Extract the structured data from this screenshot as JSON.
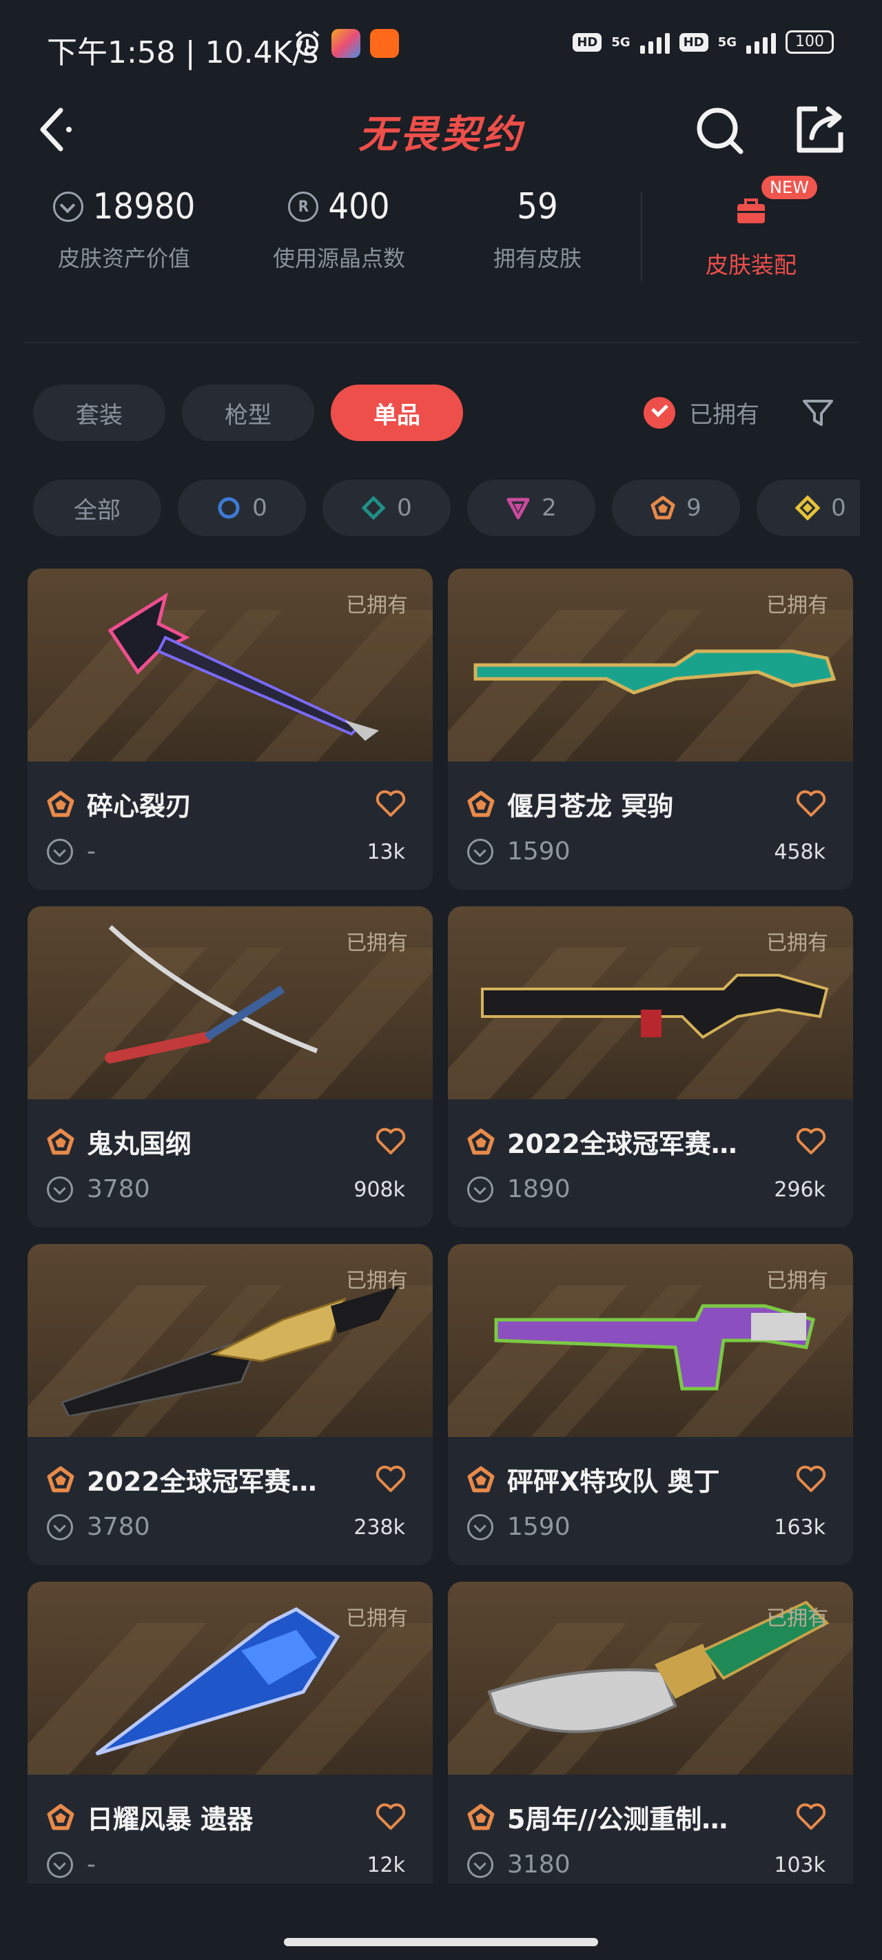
{
  "status_bar": {
    "time_speed": "下午1:58 | 10.4K/s",
    "hd1": "HD",
    "net1": "5G",
    "hd2": "HD",
    "net2": "5G",
    "battery": "100"
  },
  "header": {
    "title": "无畏契约",
    "back_icon": "back-arrow-icon",
    "search_icon": "search-icon",
    "share_icon": "share-icon"
  },
  "stats": {
    "asset_value": "18980",
    "asset_value_label": "皮肤资产价值",
    "radianite": "400",
    "radianite_label": "使用源晶点数",
    "skins_owned": "59",
    "skins_owned_label": "拥有皮肤",
    "loadout_label": "皮肤装配",
    "new_badge": "NEW"
  },
  "type_tabs": [
    {
      "label": "套装",
      "active": false
    },
    {
      "label": "枪型",
      "active": false
    },
    {
      "label": "单品",
      "active": true
    }
  ],
  "owned_filter": {
    "label": "已拥有",
    "checked": true
  },
  "tier_filters": [
    {
      "label": "全部",
      "icon": "none"
    },
    {
      "label": "0",
      "icon": "select-tier-icon",
      "color": "#3d7bd6"
    },
    {
      "label": "0",
      "icon": "deluxe-tier-icon",
      "color": "#1f8f86"
    },
    {
      "label": "2",
      "icon": "premium-tier-icon",
      "color": "#c94a9b"
    },
    {
      "label": "9",
      "icon": "exclusive-tier-icon",
      "color": "#e88a4a"
    },
    {
      "label": "0",
      "icon": "ultra-tier-icon",
      "color": "#e6c23a"
    }
  ],
  "skins": [
    {
      "name": "碎心裂刃",
      "price": "-",
      "likes": "13k",
      "owned": "已拥有"
    },
    {
      "name": "偃月苍龙 冥驹",
      "price": "1590",
      "likes": "458k",
      "owned": "已拥有"
    },
    {
      "name": "鬼丸国纲",
      "price": "3780",
      "likes": "908k",
      "owned": "已拥有"
    },
    {
      "name": "2022全球冠军赛…",
      "price": "1890",
      "likes": "296k",
      "owned": "已拥有"
    },
    {
      "name": "2022全球冠军赛…",
      "price": "3780",
      "likes": "238k",
      "owned": "已拥有"
    },
    {
      "name": "砰砰X特攻队 奥丁",
      "price": "1590",
      "likes": "163k",
      "owned": "已拥有"
    },
    {
      "name": "日耀风暴 遗器",
      "price": "-",
      "likes": "12k",
      "owned": "已拥有"
    },
    {
      "name": "5周年//公测重制…",
      "price": "3180",
      "likes": "103k",
      "owned": "已拥有"
    }
  ],
  "colors": {
    "accent": "#ee4f4a",
    "background": "#1a1e25",
    "card": "#232830",
    "exclusive_tier": "#e88a4a"
  }
}
